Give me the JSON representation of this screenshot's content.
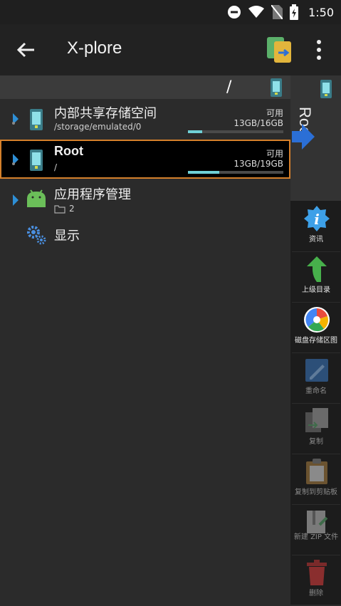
{
  "status_bar": {
    "time": "1:50"
  },
  "app_bar": {
    "title": "X-plore"
  },
  "path_bar": {
    "path": "/"
  },
  "list": [
    {
      "name": "内部共享存储空间",
      "path": "/storage/emulated/0",
      "avail_label": "可用",
      "size": "13GB/16GB",
      "used_fraction": 0.15,
      "selected": false
    },
    {
      "name": "Root",
      "path": "/",
      "avail_label": "可用",
      "size": "13GB/19GB",
      "used_fraction": 0.33,
      "selected": true
    },
    {
      "name": "应用程序管理",
      "count": "2"
    },
    {
      "name": "显示"
    }
  ],
  "right_panel": {
    "label": "Root"
  },
  "tools": [
    {
      "label": "资讯",
      "icon": "info-icon",
      "enabled": true
    },
    {
      "label": "上级目录",
      "icon": "up-arrow-icon",
      "enabled": true
    },
    {
      "label": "磁盘存储区图",
      "icon": "disk-map-icon",
      "enabled": true
    },
    {
      "label": "重命名",
      "icon": "rename-icon",
      "enabled": false
    },
    {
      "label": "复制",
      "icon": "copy-icon",
      "enabled": false
    },
    {
      "label": "复制到剪贴板",
      "icon": "clipboard-icon",
      "enabled": false
    },
    {
      "label": "新建 ZIP 文件",
      "icon": "zip-icon",
      "enabled": false
    },
    {
      "label": "删除",
      "icon": "delete-icon",
      "enabled": false
    }
  ],
  "colors": {
    "accent": "#d5802b",
    "bar_fill": "#6fd0d6",
    "arrow_blue": "#2b6fd6"
  }
}
